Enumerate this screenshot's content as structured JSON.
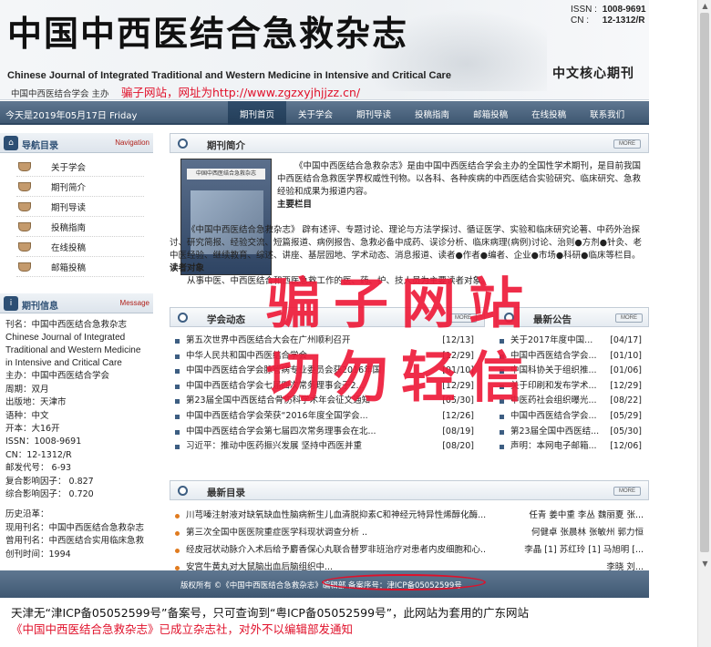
{
  "header": {
    "calligraphy_title": "中国中西医结合急救杂志",
    "english_title": "Chinese Journal of Integrated Traditional and Western Medicine in Intensive and Critical Care",
    "sponsor": "中国中西医结合学会 主办",
    "scam_url_note": "骗子网站，网址为http://www.zgzxyjhjjzz.cn/",
    "issn_label": "ISSN :",
    "issn_value": "1008-9691",
    "cn_label": "CN :",
    "cn_value": "12-1312/R",
    "core_journal": "中文核心期刊"
  },
  "navbar": {
    "today": "今天是2019年05月17日 Friday",
    "items": [
      "期刊首页",
      "关于学会",
      "期刊导读",
      "投稿指南",
      "邮箱投稿",
      "在线投稿",
      "联系我们"
    ]
  },
  "sidebar": {
    "nav_title": "导航目录",
    "nav_title_en": "Navigation",
    "items": [
      "关于学会",
      "期刊简介",
      "期刊导读",
      "投稿指南",
      "在线投稿",
      "邮箱投稿"
    ],
    "info_title": "期刊信息",
    "info_title_en": "Message",
    "info": {
      "name": "刊名：中国中西医结合急救杂志",
      "en1": "Chinese Journal of Integrated",
      "en2": "Traditional and Western Medicine",
      "en3": "in Intensive and Critical Care",
      "sponsor": "主办：中国中西医结合学会",
      "period": "周期：双月",
      "place": "出版地：天津市",
      "lang": "语种：中文",
      "size": "开本：大16开",
      "issn": "ISSN：1008-9691",
      "cn": "CN：12-1312/R",
      "post": "邮发代号： 6-93",
      "impact1": "复合影响因子： 0.827",
      "impact2": "综合影响因子： 0.720",
      "history": "历史沿革：",
      "current": "现用刊名：中国中西医结合急救杂志",
      "former": "曾用刊名：中西医结合实用临床急救",
      "founded": "创刊时间：1994"
    }
  },
  "intro": {
    "title": "期刊简介",
    "more": "MORE",
    "cover_title": "中国中西医结合急救杂志",
    "p1": "《中国中西医结合急救杂志》是由中国中西医结合学会主办的全国性学术期刊，是目前我国中西医结合急救医学界权威性刊物。以各科、各种疾病的中西医结合实验研究、临床研究、急救经验和成果为报道内容。",
    "h2": "主要栏目",
    "p2": "《中国中西医结合急救杂志》 辟有述评、专题讨论、理论与方法学探讨、循证医学、实验和临床研究论著、中药外治探讨、研究简报、经验交流、短篇报道、病例报告、急救必备中成药、误诊分析、临床病理(病例)讨论、治则●方剂●针灸、老中医经验、继续教育、综述、讲座、基层园地、学术动态、消息报道、读者●作者●编者、企业●市场●科研●临床等栏目。",
    "h3": "读者对象",
    "p3": "从事中医、中西医结合和西医急救工作的医、药、护、技人员为主要读者对象。"
  },
  "news": {
    "title": "学会动态",
    "more": "MORE",
    "items": [
      {
        "text": "第五次世界中西医结合大会在广州顺利召开",
        "date": "[12/13]"
      },
      {
        "text": "中华人民共和国中西医结合学会",
        "date": "[12/29]"
      },
      {
        "text": "中国中西医结合学会脉管病专业委员会获2016年国",
        "date": "[01/10]"
      },
      {
        "text": "中国中西医结合学会七届四次常务理事会于2...",
        "date": "[12/29]"
      },
      {
        "text": "第23届全国中西医结合骨伤科学术年会征文通知",
        "date": "[05/30]"
      },
      {
        "text": "中国中西医结合学会荣获“2016年度全国学会...",
        "date": "[12/26]"
      },
      {
        "text": "中国中西医结合学会第七届四次常务理事会在北...",
        "date": "[08/19]"
      },
      {
        "text": "习近平：推动中医药振兴发展 坚持中西医并重",
        "date": "[08/20]"
      }
    ]
  },
  "notice": {
    "title": "最新公告",
    "more": "MORE",
    "items": [
      {
        "text": "关于2017年度中国...",
        "date": "[04/17]"
      },
      {
        "text": "中国中西医结合学会...",
        "date": "[01/10]"
      },
      {
        "text": "中国科协关于组织推...",
        "date": "[01/06]"
      },
      {
        "text": "关于印刷和发布学术...",
        "date": "[12/29]"
      },
      {
        "text": "中医药社会组织曝光...",
        "date": "[08/22]"
      },
      {
        "text": "中国中西医结合学会...",
        "date": "[05/29]"
      },
      {
        "text": "第23届全国中西医结...",
        "date": "[05/30]"
      },
      {
        "text": "声明：本网电子邮箱...",
        "date": "[12/06]"
      }
    ]
  },
  "latest": {
    "title": "最新目录",
    "more": "MORE",
    "items": [
      {
        "text": "川芎嗪注射液对缺氧缺血性脑病新生儿血清脱抑素C和神经元特异性烯醇化酶...",
        "authors": "任青 姜中重 李丛 魏丽夏 张..."
      },
      {
        "text": "第三次全国中医医院重症医学科现状调查分析 ..",
        "authors": "何健卓 张晨林 张敏州 郭力恒"
      },
      {
        "text": "经皮冠状动脉介入术后给予麝香保心丸联合替罗非班治疗对患者内皮细胞和心...",
        "authors": "李晶 [1] 苏红玲 [1] 马旭明 [..."
      },
      {
        "text": "安宫牛黄丸对大鼠脑出血后脑组织中...",
        "authors": "李晓 刘..."
      }
    ]
  },
  "footer": {
    "copyright": "版权所有 ©《中国中西医结合急救杂志》编辑部  备案序号：津ICP备05052599号"
  },
  "warnings": {
    "watermark1": "骗子网站",
    "watermark2": "切勿轻信",
    "note1": "天津无“津ICP备05052599号”备案号，只可查询到“粤ICP备05052599号”，此网站为套用的广东网站",
    "note2": "《中国中西医结合急救杂志》已成立杂志社，对外不以编辑部发通知"
  },
  "colors": {
    "nav_bar": "#4a6481",
    "warning_red": "#e0102a",
    "accent_blue": "#3d5e82"
  }
}
